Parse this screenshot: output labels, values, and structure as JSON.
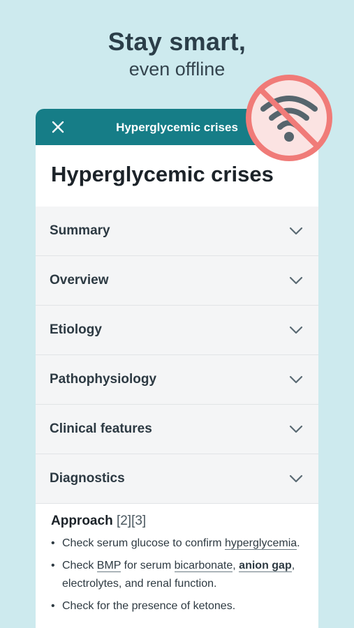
{
  "hero": {
    "title": "Stay smart,",
    "subtitle": "even offline"
  },
  "appbar": {
    "title": "Hyperglycemic crises"
  },
  "article": {
    "title": "Hyperglycemic crises",
    "sections": [
      {
        "label": "Summary"
      },
      {
        "label": "Overview"
      },
      {
        "label": "Etiology"
      },
      {
        "label": "Pathophysiology"
      },
      {
        "label": "Clinical features"
      },
      {
        "label": "Diagnostics"
      }
    ],
    "approach": {
      "heading": "Approach",
      "refs": " [2][3]"
    },
    "bullets": {
      "b1_text": "Check serum glucose to confirm ",
      "b1_link": "hyperglycemia",
      "b1_end": ".",
      "b2_text": "Check ",
      "b2_link1": "BMP",
      "b2_mid": " for serum ",
      "b2_link2": "bicarbonate",
      "b2_comma": ", ",
      "b2_link3": "anion gap",
      "b2_end": ", electrolytes, and renal function.",
      "b3_text": "Check for the presence of ketones."
    }
  },
  "icons": {
    "close": "close-icon",
    "chevron": "chevron-down-icon",
    "no_wifi": "no-wifi-icon"
  },
  "colors": {
    "background": "#cdeaee",
    "appbar": "#167d87",
    "no_wifi_red": "#f07b78"
  }
}
